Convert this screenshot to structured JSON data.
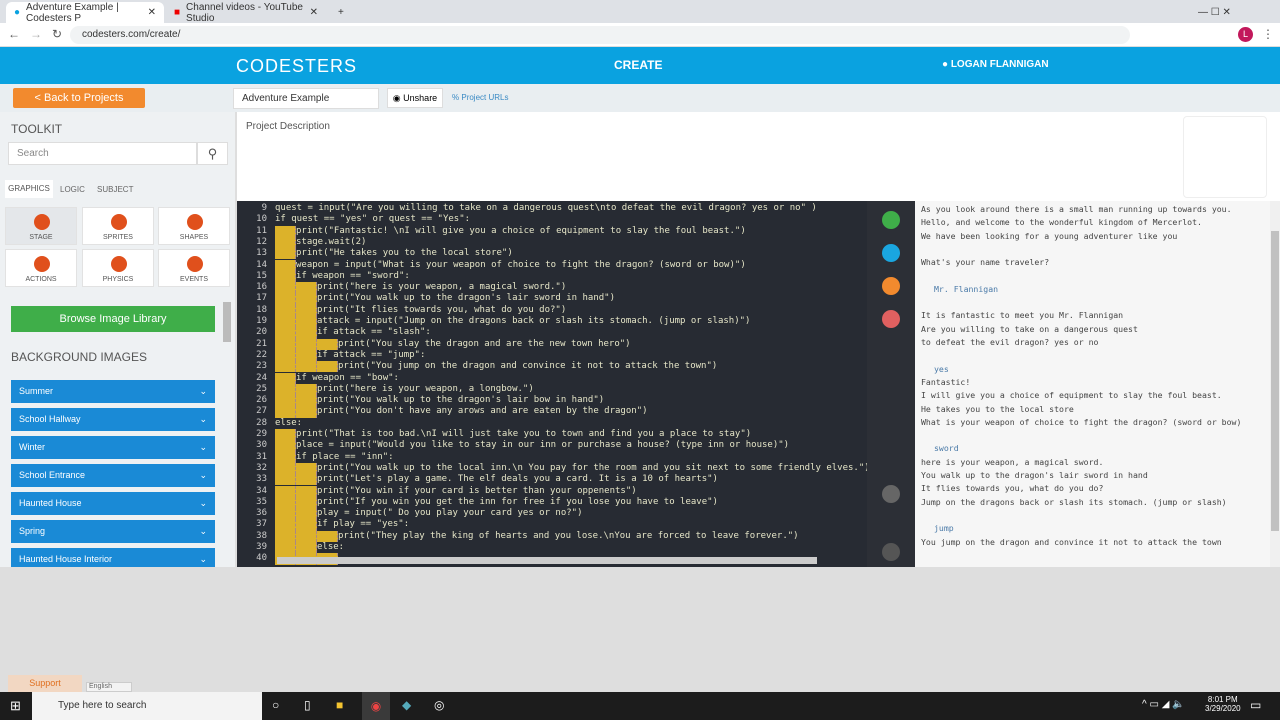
{
  "browser": {
    "tabs": [
      {
        "title": "Adventure Example | Codesters P"
      },
      {
        "title": "Channel videos - YouTube Studio"
      }
    ],
    "url": "codesters.com/create/",
    "profile_initial": "L"
  },
  "header": {
    "logo": "CODESTERS",
    "center": "CREATE",
    "user": "LOGAN FLANNIGAN"
  },
  "toolbar": {
    "back": "< Back to Projects",
    "project_name": "Adventure Example",
    "unshare": "Unshare",
    "project_urls": "Project URLs"
  },
  "toolkit": {
    "title": "TOOLKIT",
    "search_placeholder": "Search",
    "tabs": [
      "GRAPHICS",
      "LOGIC",
      "SUBJECT"
    ],
    "tools": [
      "STAGE",
      "SPRITES",
      "SHAPES",
      "ACTIONS",
      "PHYSICS",
      "EVENTS"
    ],
    "browse": "Browse Image Library",
    "bg_title": "BACKGROUND IMAGES",
    "backgrounds": [
      "Summer",
      "School Hallway",
      "Winter",
      "School Entrance",
      "Haunted House",
      "Spring",
      "Haunted House Interior"
    ]
  },
  "description": {
    "label": "Project Description"
  },
  "code": [
    {
      "n": "9",
      "i": 0,
      "t": "quest = input(\"Are you willing to take on a dangerous quest\\nto defeat the evil dragon? yes or no\" )"
    },
    {
      "n": "10",
      "i": 0,
      "t": "if quest == \"yes\" or quest == \"Yes\":"
    },
    {
      "n": "11",
      "i": 1,
      "t": "print(\"Fantastic! \\nI will give you a choice of equipment to slay the foul beast.\")"
    },
    {
      "n": "12",
      "i": 1,
      "t": "stage.wait(2)"
    },
    {
      "n": "13",
      "i": 1,
      "t": "print(\"He takes you to the local store\")"
    },
    {
      "n": "14",
      "i": 1,
      "t": "weapon = input(\"What is your weapon of choice to fight the dragon? (sword or bow)\")"
    },
    {
      "n": "15",
      "i": 1,
      "t": "if weapon == \"sword\":"
    },
    {
      "n": "16",
      "i": 2,
      "t": "print(\"here is your weapon, a magical sword.\")"
    },
    {
      "n": "17",
      "i": 2,
      "t": "print(\"You walk up to the dragon's lair sword in hand\")"
    },
    {
      "n": "18",
      "i": 2,
      "t": "print(\"It flies towards you, what do you do?\")"
    },
    {
      "n": "19",
      "i": 2,
      "t": "attack = input(\"Jump on the dragons back or slash its stomach. (jump or slash)\")"
    },
    {
      "n": "20",
      "i": 2,
      "t": "if attack == \"slash\":"
    },
    {
      "n": "21",
      "i": 3,
      "t": "print(\"You slay the dragon and are the new town hero\")"
    },
    {
      "n": "22",
      "i": 2,
      "t": "if attack == \"jump\":"
    },
    {
      "n": "23",
      "i": 3,
      "t": "print(\"You jump on the dragon and convince it not to attack the town\")"
    },
    {
      "n": "24",
      "i": 1,
      "t": "if weapon == \"bow\":"
    },
    {
      "n": "25",
      "i": 2,
      "t": "print(\"here is your weapon, a longbow.\")"
    },
    {
      "n": "26",
      "i": 2,
      "t": "print(\"You walk up to the dragon's lair bow in hand\")"
    },
    {
      "n": "27",
      "i": 2,
      "t": "print(\"You don't have any arows and are eaten by the dragon\")"
    },
    {
      "n": "28",
      "i": 0,
      "t": "else:"
    },
    {
      "n": "29",
      "i": 1,
      "t": "print(\"That is too bad.\\nI will just take you to town and find you a place to stay\")"
    },
    {
      "n": "30",
      "i": 1,
      "t": "place = input(\"Would you like to stay in our inn or purchase a house? (type inn or house)\")"
    },
    {
      "n": "31",
      "i": 1,
      "t": "if place == \"inn\":"
    },
    {
      "n": "32",
      "i": 2,
      "t": "print(\"You walk up to the local inn.\\n You pay for the room and you sit next to some friendly elves.\")"
    },
    {
      "n": "33",
      "i": 2,
      "t": "print(\"Let's play a game. The elf deals you a card. It is a 10 of hearts\")"
    },
    {
      "n": "34",
      "i": 2,
      "t": "print(\"You win if your card is better than your oppenents\")"
    },
    {
      "n": "35",
      "i": 2,
      "t": "print(\"If you win you get the inn for free if you lose you have to leave\")"
    },
    {
      "n": "36",
      "i": 2,
      "t": "play = input(\" Do you play your card yes or no?\")"
    },
    {
      "n": "37",
      "i": 2,
      "t": "if play == \"yes\":"
    },
    {
      "n": "38",
      "i": 3,
      "t": "print(\"They play the king of hearts and you lose.\\nYou are forced to leave forever.\")"
    },
    {
      "n": "39",
      "i": 2,
      "t": "else:"
    },
    {
      "n": "40",
      "i": 3,
      "t": ""
    }
  ],
  "console": [
    {
      "t": "As you look around there is a small man running up towards you.",
      "in": false
    },
    {
      "t": "Hello, and welcome to the wonderful kingdom of Mercerlot.",
      "in": false
    },
    {
      "t": "We have been looking for a young adventurer like you",
      "in": false
    },
    {
      "t": "",
      "in": false
    },
    {
      "t": "What's your name traveler?",
      "in": false
    },
    {
      "t": "",
      "in": false
    },
    {
      "t": "Mr. Flannigan",
      "in": true
    },
    {
      "t": "",
      "in": false
    },
    {
      "t": "It is fantastic to meet you Mr. Flannigan",
      "in": false
    },
    {
      "t": "Are you willing to take on a dangerous quest",
      "in": false
    },
    {
      "t": "to defeat the evil dragon? yes or no",
      "in": false
    },
    {
      "t": "",
      "in": false
    },
    {
      "t": "yes",
      "in": true
    },
    {
      "t": "Fantastic!",
      "in": false
    },
    {
      "t": "I will give you a choice of equipment to slay the foul beast.",
      "in": false
    },
    {
      "t": "He takes you to the local store",
      "in": false
    },
    {
      "t": "What is your weapon of choice to fight the dragon? (sword or bow)",
      "in": false
    },
    {
      "t": "",
      "in": false
    },
    {
      "t": "sword",
      "in": true
    },
    {
      "t": "here is your weapon, a magical sword.",
      "in": false
    },
    {
      "t": "You walk up to the dragon's lair sword in hand",
      "in": false
    },
    {
      "t": "It flies towards you, what do you do?",
      "in": false
    },
    {
      "t": "Jump on the dragons back or slash its stomach. (jump or slash)",
      "in": false
    },
    {
      "t": "",
      "in": false
    },
    {
      "t": "jump",
      "in": true
    },
    {
      "t": "You jump on the dragon and convince it not to attack the town",
      "in": false
    }
  ],
  "footer": {
    "support": "Support",
    "language": "English"
  },
  "taskbar": {
    "search_placeholder": "Type here to search",
    "time": "8:01 PM",
    "date": "3/29/2020"
  },
  "colors": {
    "brand": "#0aa2e0",
    "accent": "#f28a2e",
    "green": "#3fae49",
    "editor_bg": "#272b33"
  }
}
